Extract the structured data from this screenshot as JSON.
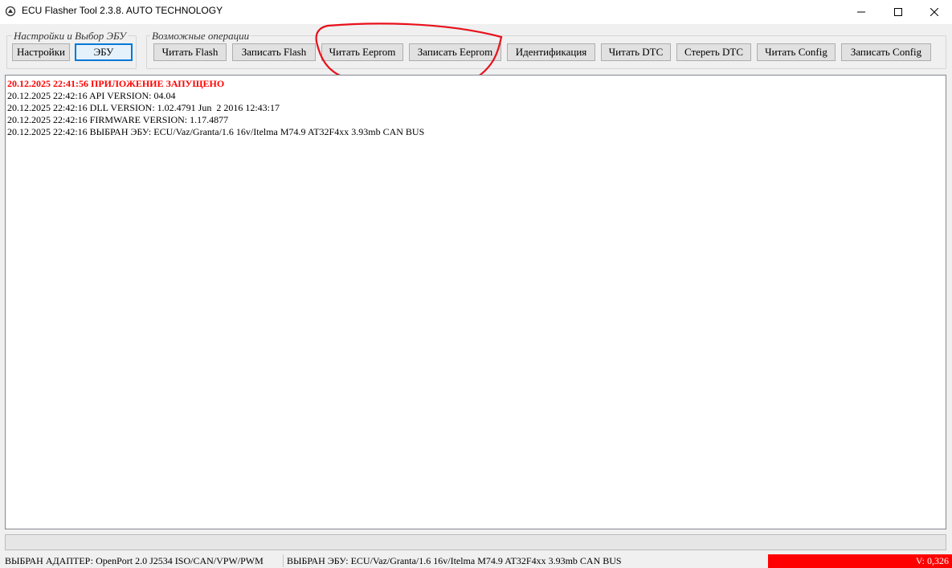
{
  "window": {
    "title": "ECU Flasher Tool 2.3.8. AUTO TECHNOLOGY",
    "icon": "app-icon",
    "controls": [
      "minimize-icon",
      "maximize-icon",
      "close-icon"
    ]
  },
  "groups": {
    "settings_title": "Настройки и Выбор ЭБУ",
    "operations_title": "Возможные операции"
  },
  "buttons": {
    "settings": "Настройки",
    "ecu": "ЭБУ",
    "read_flash": "Читать Flash",
    "write_flash": "Записать Flash",
    "read_eeprom": "Читать Eeprom",
    "write_eeprom": "Записать Eeprom",
    "identification": "Идентификация",
    "read_dtc": "Читать DTC",
    "clear_dtc": "Стереть DTC",
    "read_config": "Читать Config",
    "write_config": "Записать Config"
  },
  "log": [
    {
      "text": "20.12.2025 22:41:56 ПРИЛОЖЕНИЕ ЗАПУЩЕНО",
      "highlight": true
    },
    {
      "text": "20.12.2025 22:42:16 API VERSION: 04.04",
      "highlight": false
    },
    {
      "text": "20.12.2025 22:42:16 DLL VERSION: 1.02.4791 Jun  2 2016 12:43:17",
      "highlight": false
    },
    {
      "text": "20.12.2025 22:42:16 FIRMWARE VERSION: 1.17.4877",
      "highlight": false
    },
    {
      "text": "20.12.2025 22:42:16 ВЫБРАН ЭБУ: ECU/Vaz/Granta/1.6 16v/Itelma M74.9 AT32F4xx 3.93mb CAN BUS",
      "highlight": false
    }
  ],
  "progress": {
    "value": 0
  },
  "status": {
    "adapter": "ВЫБРАН АДАПТЕР: OpenPort 2.0 J2534 ISO/CAN/VPW/PWM",
    "ecu": "ВЫБРАН ЭБУ: ECU/Vaz/Granta/1.6 16v/Itelma M74.9 AT32F4xx 3.93mb CAN BUS",
    "version": "V: 0,326"
  },
  "colors": {
    "log_highlight": "#ff0000",
    "version_bg": "#ff0000",
    "annotation": "#e8101a",
    "default_button_border": "#0078d7"
  }
}
